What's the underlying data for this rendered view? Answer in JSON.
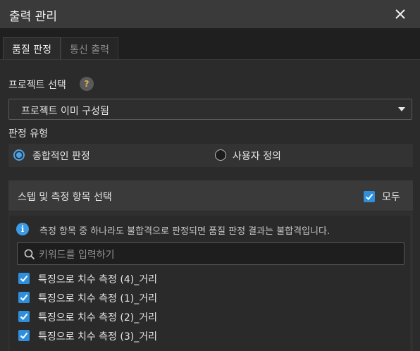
{
  "window": {
    "title": "출력 관리",
    "close_icon": "close-icon"
  },
  "tabs": [
    {
      "label": "품질 판정",
      "active": true
    },
    {
      "label": "통신 출력",
      "active": false
    }
  ],
  "project": {
    "label": "프로젝트 선택",
    "help": "?",
    "selected": "프로젝트 이미 구성됨"
  },
  "judgement": {
    "label": "판정 유형",
    "options": [
      {
        "label": "종합적인 판정",
        "selected": true
      },
      {
        "label": "사용자 정의",
        "selected": false
      }
    ]
  },
  "steps": {
    "header": "스텝 및 측정 항목 선택",
    "select_all_label": "모두",
    "select_all_checked": true,
    "info_glyph": "i",
    "info_text": "측정 항목 중 하나라도 불합격으로 판정되면 품질 판정 결과는 불합격입니다.",
    "search_placeholder": "키워드를 입력하기",
    "items": [
      {
        "label": "특징으로 치수 측정 (4)_거리",
        "checked": true
      },
      {
        "label": "특징으로 치수 측정 (1)_거리",
        "checked": true
      },
      {
        "label": "특징으로 치수 측정 (2)_거리",
        "checked": true
      },
      {
        "label": "특징으로 치수 측정 (3)_거리",
        "checked": true
      }
    ]
  },
  "colors": {
    "accent": "#2f8fdd",
    "background": "#2b2b2b",
    "titlebar": "#3a3a3a"
  }
}
